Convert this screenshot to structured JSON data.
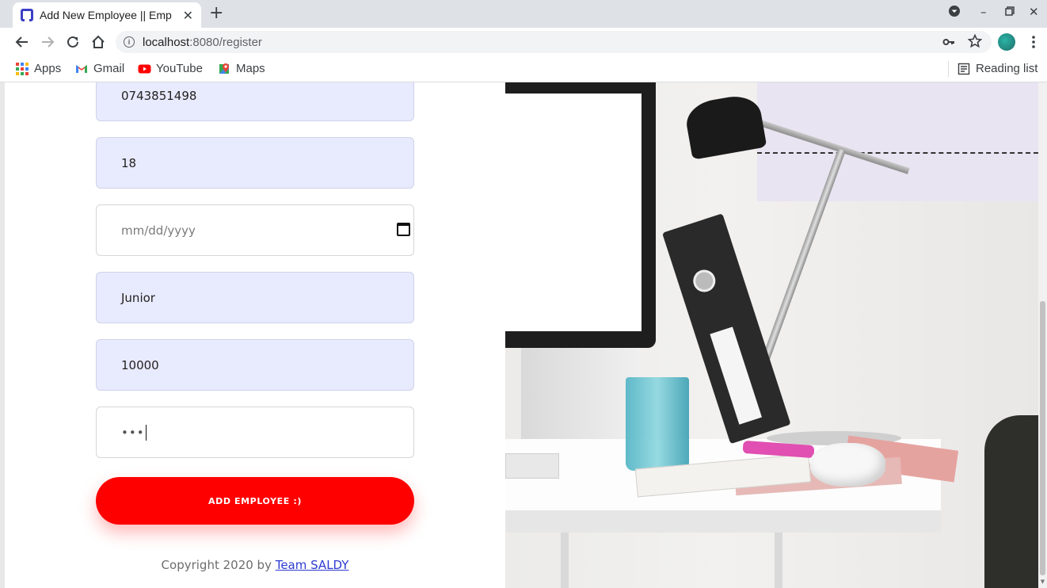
{
  "browser": {
    "tab_title": "Add New Employee || Emp",
    "url_host": "localhost",
    "url_rest": ":8080/register",
    "bookmarks": [
      {
        "label": "Apps",
        "icon": "apps-grid-icon"
      },
      {
        "label": "Gmail",
        "icon": "gmail-icon"
      },
      {
        "label": "YouTube",
        "icon": "youtube-icon"
      },
      {
        "label": "Maps",
        "icon": "maps-icon"
      }
    ],
    "reading_list": "Reading list"
  },
  "form": {
    "phone_value": "0743851498",
    "age_value": "18",
    "date_placeholder": "mm/dd/yyyy",
    "position_value": "Junior",
    "salary_value": "10000",
    "password_mask": "•••",
    "submit_label": "ADD EMPLOYEE :)"
  },
  "footer": {
    "copyright_text": "Copyright 2020 by ",
    "team_link": "Team SALDY"
  },
  "colors": {
    "accent": "#ff0000",
    "input_fill": "#e8eafd",
    "link": "#2d3bd1"
  }
}
